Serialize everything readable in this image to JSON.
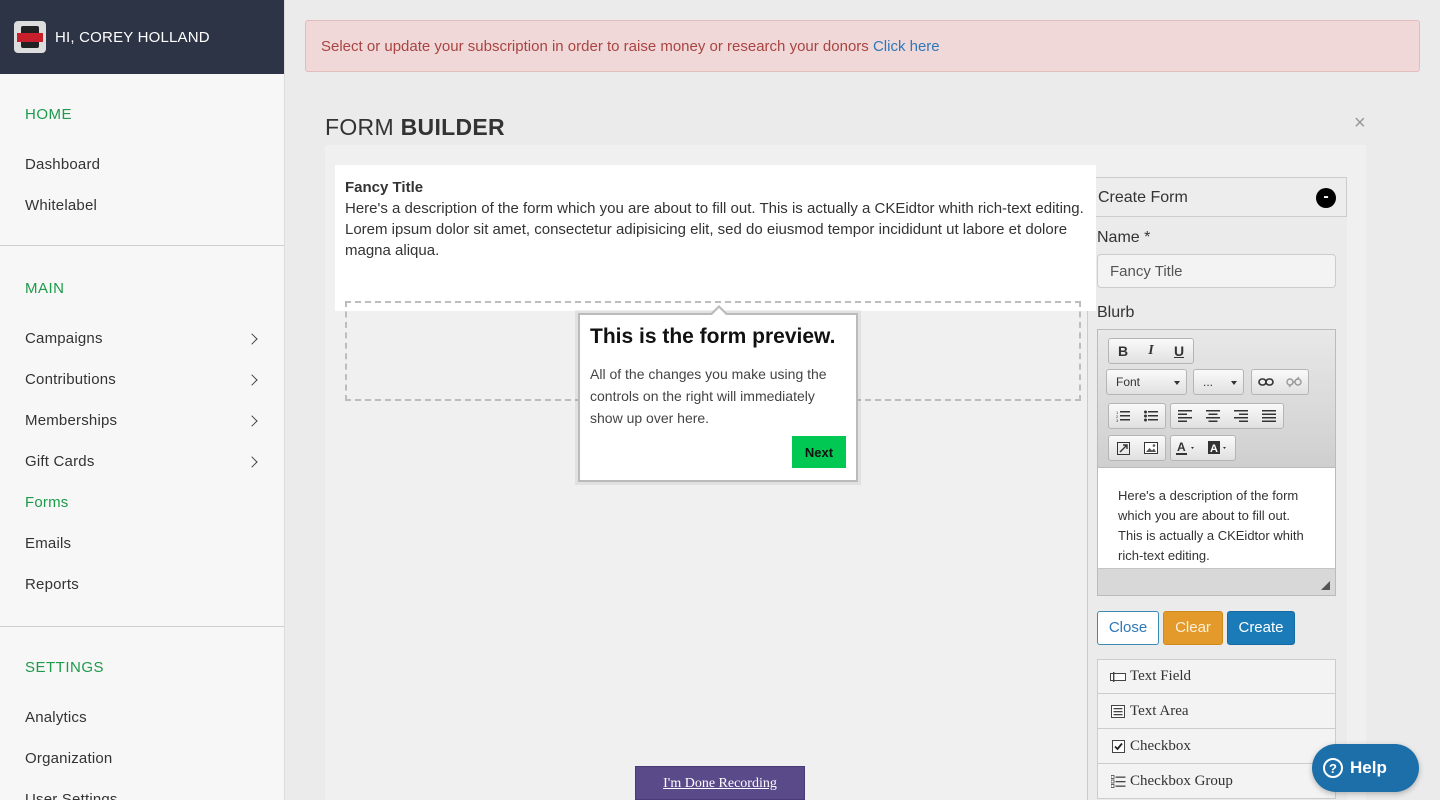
{
  "sidebar": {
    "greeting": "HI, COREY HOLLAND",
    "sections": {
      "home": {
        "heading": "HOME",
        "items": [
          "Dashboard",
          "Whitelabel"
        ]
      },
      "main": {
        "heading": "MAIN",
        "items": [
          "Campaigns",
          "Contributions",
          "Memberships",
          "Gift Cards",
          "Forms",
          "Emails",
          "Reports"
        ]
      },
      "settings": {
        "heading": "SETTINGS",
        "items": [
          "Analytics",
          "Organization",
          "User Settings"
        ]
      }
    },
    "active_item": "Forms"
  },
  "alert": {
    "message": "Select or update your subscription in order to raise money or research your donors",
    "link": "Click here"
  },
  "page": {
    "title_light": "FORM",
    "title_bold": "BUILDER",
    "close_symbol": "×"
  },
  "preview": {
    "title": "Fancy Title",
    "line1": "Here's a description of the form which you are about to fill out. This is actually a CKEidtor whith rich-text editing.",
    "line2": "Lorem ipsum dolor sit amet, consectetur adipisicing elit, sed do eiusmod tempor incididunt ut labore et dolore magna aliqua."
  },
  "popover": {
    "title": "This is the form preview.",
    "text": "All of the changes you make using the controls on the right will immediately show up over here.",
    "next_label": "Next"
  },
  "panel": {
    "header": "Create Form",
    "collapse_symbol": "-",
    "name_label": "Name *",
    "name_value": "Fancy Title",
    "blurb_label": "Blurb",
    "editor": {
      "bold": "B",
      "italic": "I",
      "underline": "U",
      "font_select": "Font",
      "size_select": "...",
      "body": "Here's a description of the form which you are about to fill out. This is actually a CKEidtor whith rich-text editing."
    },
    "buttons": {
      "close": "Close",
      "clear": "Clear",
      "create": "Create"
    },
    "fields": [
      "Text Field",
      "Text Area",
      "Checkbox",
      "Checkbox Group"
    ]
  },
  "recording": {
    "label": "I'm Done Recording"
  },
  "help": {
    "label": "Help",
    "symbol": "?"
  }
}
